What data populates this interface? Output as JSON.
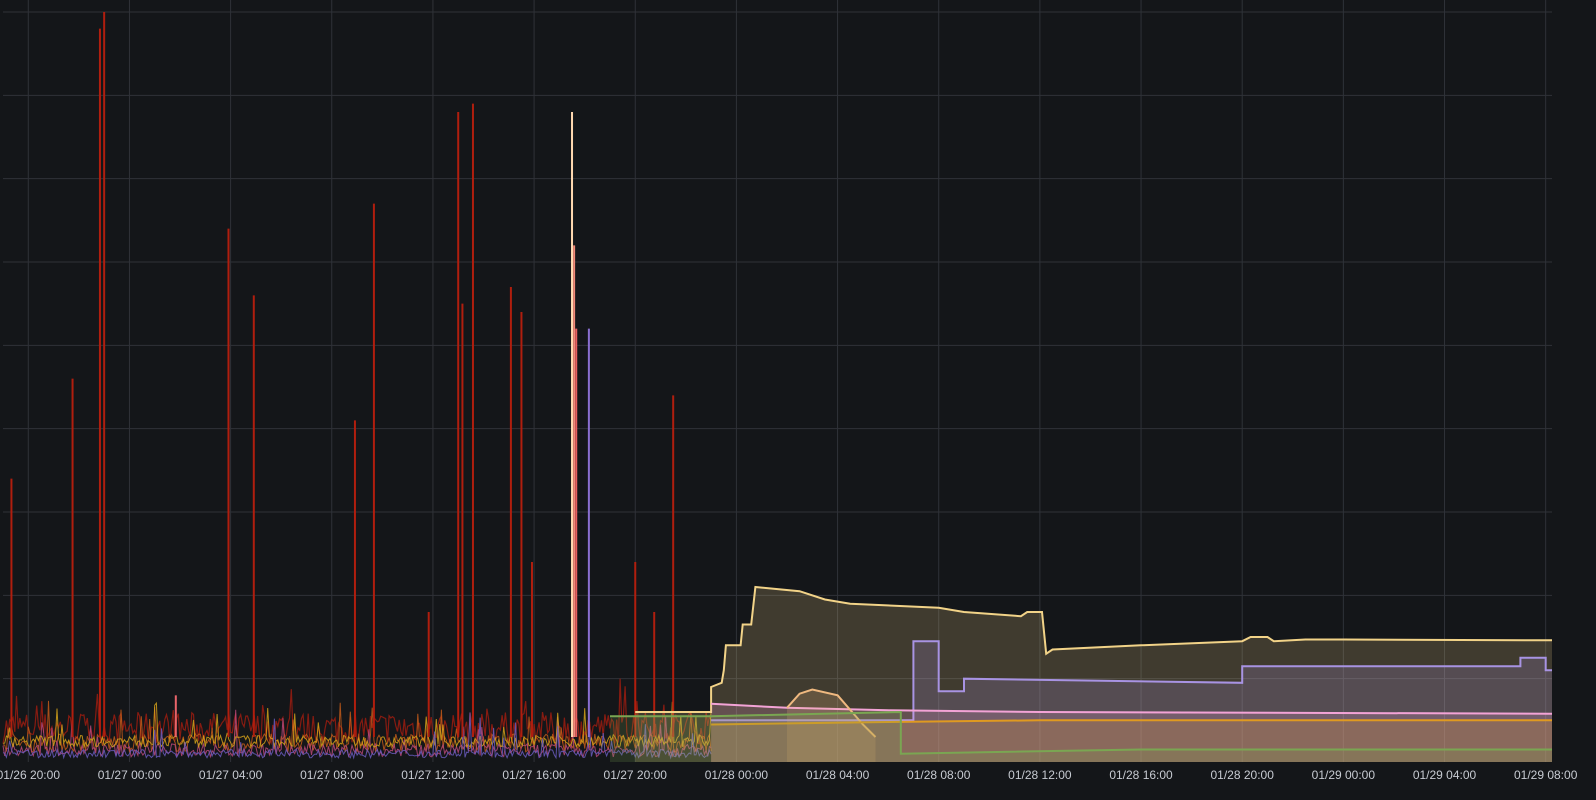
{
  "chart_data": {
    "type": "area",
    "title": "",
    "xlabel": "",
    "ylabel": "",
    "theme": "dark",
    "grid": true,
    "legend": "none",
    "background": "#141619",
    "x_start": "01/26 19:00",
    "x_end": "01/29 08:15",
    "x_ticks": [
      "01/26 20:00",
      "01/27 00:00",
      "01/27 04:00",
      "01/27 08:00",
      "01/27 12:00",
      "01/27 16:00",
      "01/27 20:00",
      "01/28 00:00",
      "01/28 04:00",
      "01/28 08:00",
      "01/28 12:00",
      "01/28 16:00",
      "01/28 20:00",
      "01/29 00:00",
      "01/29 04:00",
      "01/29 08:00"
    ],
    "ylim": [
      0,
      9
    ],
    "gridlines_y": [
      1,
      2,
      3,
      4,
      5,
      6,
      7,
      8,
      9
    ],
    "spikes": [
      {
        "t": "01/26 19:20",
        "v": 3.4,
        "color": "#b01e0e"
      },
      {
        "t": "01/26 21:45",
        "v": 4.6,
        "color": "#b01e0e"
      },
      {
        "t": "01/26 22:50",
        "v": 8.8,
        "color": "#b01e0e"
      },
      {
        "t": "01/26 23:00",
        "v": 9.0,
        "color": "#b01e0e"
      },
      {
        "t": "01/27 01:50",
        "v": 0.8,
        "color": "#e8646a"
      },
      {
        "t": "01/27 03:55",
        "v": 6.4,
        "color": "#b01e0e"
      },
      {
        "t": "01/27 04:55",
        "v": 5.6,
        "color": "#b01e0e"
      },
      {
        "t": "01/27 08:55",
        "v": 4.1,
        "color": "#b01e0e"
      },
      {
        "t": "01/27 09:40",
        "v": 6.7,
        "color": "#b01e0e"
      },
      {
        "t": "01/27 11:50",
        "v": 1.8,
        "color": "#b01e0e"
      },
      {
        "t": "01/27 13:00",
        "v": 7.8,
        "color": "#b01e0e"
      },
      {
        "t": "01/27 13:10",
        "v": 5.5,
        "color": "#b01e0e"
      },
      {
        "t": "01/27 13:35",
        "v": 7.9,
        "color": "#b01e0e"
      },
      {
        "t": "01/27 15:05",
        "v": 5.7,
        "color": "#b01e0e"
      },
      {
        "t": "01/27 15:30",
        "v": 5.4,
        "color": "#b01e0e"
      },
      {
        "t": "01/27 15:55",
        "v": 2.4,
        "color": "#b01e0e"
      },
      {
        "t": "01/27 17:30",
        "v": 7.8,
        "color": "#ffd9b0"
      },
      {
        "t": "01/27 17:35",
        "v": 6.2,
        "color": "#f08a78"
      },
      {
        "t": "01/27 17:40",
        "v": 5.2,
        "color": "#e86060"
      },
      {
        "t": "01/27 18:10",
        "v": 5.2,
        "color": "#8a6fd1"
      },
      {
        "t": "01/27 20:00",
        "v": 2.4,
        "color": "#b01e0e"
      },
      {
        "t": "01/27 20:45",
        "v": 1.8,
        "color": "#b01e0e"
      },
      {
        "t": "01/27 21:30",
        "v": 4.4,
        "color": "#b01e0e"
      }
    ],
    "series": [
      {
        "name": "",
        "color": "#f2d388",
        "points": [
          [
            "01/27 20:00",
            0.6
          ],
          [
            "01/27 23:00",
            0.6
          ],
          [
            "01/27 23:00",
            0.9
          ],
          [
            "01/27 23:25",
            0.95
          ],
          [
            "01/27 23:30",
            1.1
          ],
          [
            "01/27 23:35",
            1.4
          ],
          [
            "01/28 00:10",
            1.4
          ],
          [
            "01/28 00:15",
            1.65
          ],
          [
            "01/28 00:35",
            1.65
          ],
          [
            "01/28 00:45",
            2.1
          ],
          [
            "01/28 02:30",
            2.05
          ],
          [
            "01/28 03:30",
            1.95
          ],
          [
            "01/28 04:30",
            1.9
          ],
          [
            "01/28 08:00",
            1.85
          ],
          [
            "01/28 09:00",
            1.8
          ],
          [
            "01/28 11:15",
            1.75
          ],
          [
            "01/28 11:30",
            1.8
          ],
          [
            "01/28 12:05",
            1.8
          ],
          [
            "01/28 12:15",
            1.3
          ],
          [
            "01/28 12:30",
            1.35
          ],
          [
            "01/28 16:00",
            1.4
          ],
          [
            "01/28 20:00",
            1.45
          ],
          [
            "01/28 20:20",
            1.5
          ],
          [
            "01/28 21:00",
            1.5
          ],
          [
            "01/28 21:15",
            1.45
          ],
          [
            "01/28 22:30",
            1.47
          ],
          [
            "01/29 00:00",
            1.47
          ],
          [
            "01/29 08:15",
            1.46
          ]
        ]
      },
      {
        "name": "",
        "color": "#a893e3",
        "points": [
          [
            "01/27 23:00",
            0.5
          ],
          [
            "01/28 07:00",
            0.5
          ],
          [
            "01/28 07:00",
            1.45
          ],
          [
            "01/28 08:00",
            1.45
          ],
          [
            "01/28 08:00",
            0.85
          ],
          [
            "01/28 09:00",
            0.85
          ],
          [
            "01/28 09:00",
            1.0
          ],
          [
            "01/28 20:00",
            0.95
          ],
          [
            "01/28 20:00",
            1.15
          ],
          [
            "01/29 07:00",
            1.15
          ],
          [
            "01/29 07:00",
            1.25
          ],
          [
            "01/29 08:00",
            1.25
          ],
          [
            "01/29 08:00",
            1.1
          ],
          [
            "01/29 08:15",
            1.1
          ]
        ]
      },
      {
        "name": "",
        "color": "#f3a3d6",
        "points": [
          [
            "01/27 23:00",
            0.7
          ],
          [
            "01/28 02:00",
            0.65
          ],
          [
            "01/28 06:00",
            0.62
          ],
          [
            "01/28 12:00",
            0.6
          ],
          [
            "01/29 08:15",
            0.58
          ]
        ]
      },
      {
        "name": "",
        "color": "#f0b980",
        "points": [
          [
            "01/28 02:00",
            0.65
          ],
          [
            "01/28 02:30",
            0.82
          ],
          [
            "01/28 03:00",
            0.87
          ],
          [
            "01/28 04:00",
            0.8
          ],
          [
            "01/28 05:00",
            0.45
          ],
          [
            "01/28 05:30",
            0.3
          ]
        ]
      },
      {
        "name": "",
        "color": "#e09a20",
        "points": [
          [
            "01/27 23:00",
            0.45
          ],
          [
            "01/28 06:00",
            0.48
          ],
          [
            "01/28 12:00",
            0.5
          ],
          [
            "01/29 08:15",
            0.5
          ]
        ]
      },
      {
        "name": "",
        "color": "#7aa652",
        "points": [
          [
            "01/27 19:00",
            0.55
          ],
          [
            "01/27 23:00",
            0.55
          ],
          [
            "01/28 06:30",
            0.6
          ],
          [
            "01/28 06:30",
            0.1
          ],
          [
            "01/28 16:00",
            0.15
          ],
          [
            "01/29 08:15",
            0.15
          ]
        ]
      }
    ]
  }
}
